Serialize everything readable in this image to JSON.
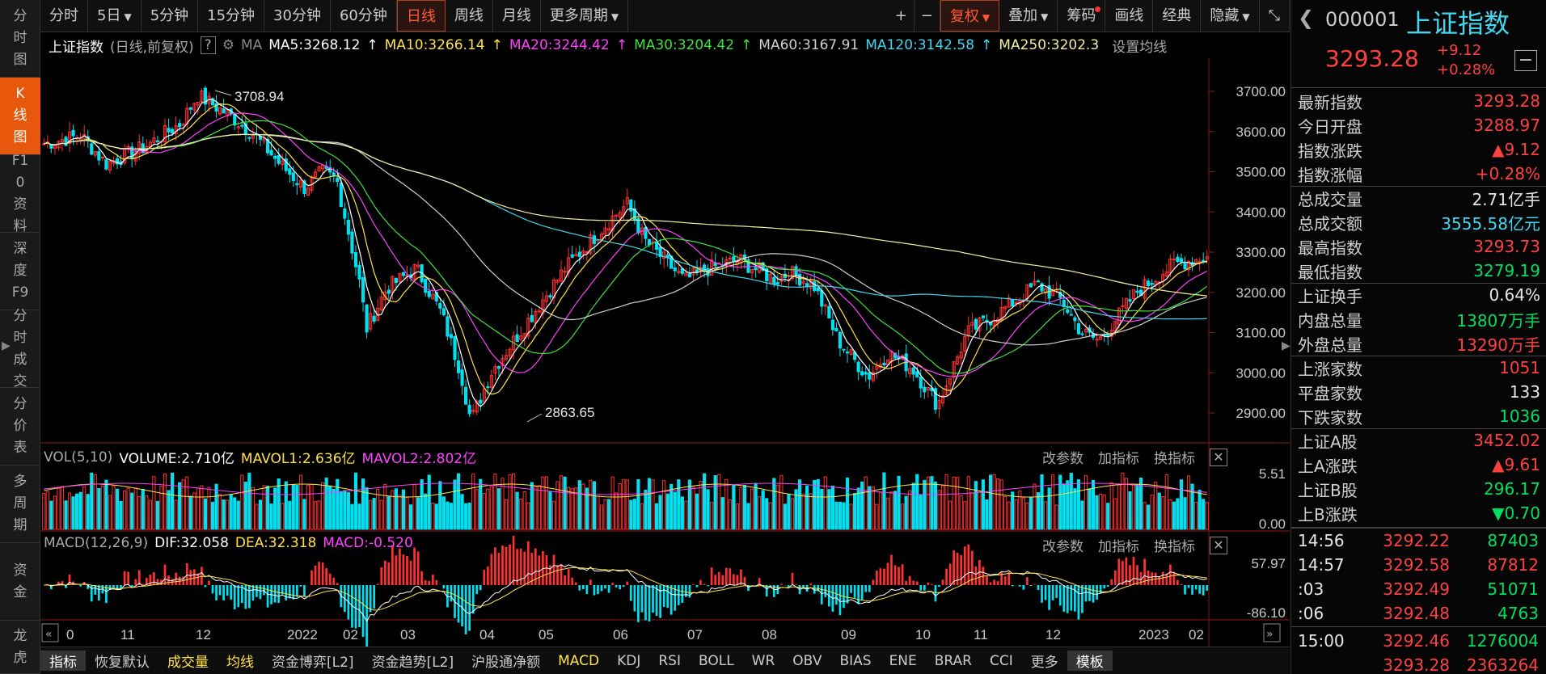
{
  "sidebar": [
    {
      "label": "分时图",
      "active": false
    },
    {
      "label": "K线图",
      "active": true
    },
    {
      "label": "F10资料",
      "active": false
    },
    {
      "label": "深度F9",
      "active": false
    },
    {
      "label": "分时成交",
      "active": false
    },
    {
      "label": "分价表",
      "active": false
    },
    {
      "label": "多周期",
      "active": false
    },
    {
      "label": "资金",
      "active": false
    },
    {
      "label": "龙虎",
      "active": false
    }
  ],
  "toolbar": {
    "periods": [
      "分时",
      "5日",
      "5分钟",
      "15分钟",
      "30分钟",
      "60分钟",
      "日线",
      "周线",
      "月线",
      "更多周期"
    ],
    "selected": "日线",
    "right": [
      "+",
      "−",
      "复权",
      "叠加",
      "筹码",
      "画线",
      "经典",
      "隐藏",
      "⤡"
    ]
  },
  "ma_bar": {
    "name": "上证指数",
    "mode": "(日线,前复权)",
    "help": "?",
    "ma_label": "MA",
    "items": [
      {
        "text": "MA5:3268.12",
        "color": "#ffffff"
      },
      {
        "text": "MA10:3266.14",
        "color": "#ffe24a"
      },
      {
        "text": "MA20:3244.42",
        "color": "#ff40ff"
      },
      {
        "text": "MA30:3204.42",
        "color": "#40e040"
      },
      {
        "text": "MA60:3167.91",
        "color": "#d0d0d0"
      },
      {
        "text": "MA120:3142.58",
        "color": "#40d8f0"
      },
      {
        "text": "MA250:3202.3",
        "color": "#f0f0a0"
      }
    ],
    "settings": "设置均线"
  },
  "kline": {
    "high_label": "3708.94",
    "low_label": "2863.65",
    "y_ticks": [
      "3700.00",
      "3600.00",
      "3500.00",
      "3400.00",
      "3300.00",
      "3200.00",
      "3100.00",
      "3000.00",
      "2900.00"
    ],
    "y_values": [
      3700,
      3600,
      3500,
      3400,
      3300,
      3200,
      3100,
      3000,
      2900
    ]
  },
  "vol_panel": {
    "title": "VOL(5,10)",
    "volume": "VOLUME:2.710亿",
    "mavol1": "MAVOL1:2.636亿",
    "mavol2": "MAVOL2:2.802亿",
    "ticks": [
      "5.51",
      "0.00"
    ],
    "buttons": [
      "改参数",
      "加指标",
      "换指标"
    ]
  },
  "macd_panel": {
    "title": "MACD(12,26,9)",
    "dif": "DIF:32.058",
    "dea": "DEA:32.318",
    "macd": "MACD:-0.520",
    "ticks": [
      "57.97",
      "-86.10"
    ],
    "buttons": [
      "改参数",
      "加指标",
      "换指标"
    ]
  },
  "x_axis": [
    "0",
    "11",
    "12",
    "2022",
    "02",
    "03",
    "04",
    "05",
    "06",
    "07",
    "08",
    "09",
    "10",
    "11",
    "12",
    "2023",
    "02"
  ],
  "bottom": {
    "items": [
      "指标",
      "恢复默认",
      "成交量",
      "均线",
      "资金博弈[L2]",
      "资金趋势[L2]",
      "沪股通净额",
      "MACD",
      "KDJ",
      "RSI",
      "BOLL",
      "WR",
      "OBV",
      "BIAS",
      "ENE",
      "BRAR",
      "CCI",
      "更多",
      "模板"
    ]
  },
  "quote": {
    "code": "000001",
    "name": "上证指数",
    "price": "3293.28",
    "change": "+9.12",
    "pct": "+0.28%",
    "stats": [
      {
        "k": "最新指数",
        "v": "3293.28",
        "c": "red"
      },
      {
        "k": "今日开盘",
        "v": "3288.97",
        "c": "red"
      },
      {
        "k": "指数涨跌",
        "v": "▲9.12",
        "c": "red"
      },
      {
        "k": "指数涨幅",
        "v": "+0.28%",
        "c": "red"
      },
      {
        "k": "总成交量",
        "v": "2.71亿手",
        "c": "wht"
      },
      {
        "k": "总成交额",
        "v": "3555.58亿元",
        "c": "cya"
      },
      {
        "k": "最高指数",
        "v": "3293.73",
        "c": "red"
      },
      {
        "k": "最低指数",
        "v": "3279.19",
        "c": "grn"
      },
      {
        "k": "上证换手",
        "v": "0.64%",
        "c": "wht"
      },
      {
        "k": "内盘总量",
        "v": "13807万手",
        "c": "grn"
      },
      {
        "k": "外盘总量",
        "v": "13290万手",
        "c": "red"
      },
      {
        "k": "上涨家数",
        "v": "1051",
        "c": "red"
      },
      {
        "k": "平盘家数",
        "v": "133",
        "c": "wht"
      },
      {
        "k": "下跌家数",
        "v": "1036",
        "c": "grn"
      },
      {
        "k": "上证A股",
        "v": "3452.02",
        "c": "red"
      },
      {
        "k": "上A涨跌",
        "v": "▲9.61",
        "c": "red"
      },
      {
        "k": "上证B股",
        "v": "296.17",
        "c": "grn"
      },
      {
        "k": "上B涨跌",
        "v": "▼0.70",
        "c": "grn"
      }
    ],
    "ticks": [
      {
        "t": "14:56",
        "p": "3292.22",
        "pc": "red",
        "v": "87403",
        "vc": "grn"
      },
      {
        "t": "14:57",
        "p": "3292.58",
        "pc": "red",
        "v": "87812",
        "vc": "red"
      },
      {
        "t": ":03",
        "p": "3292.49",
        "pc": "red",
        "v": "51071",
        "vc": "grn"
      },
      {
        "t": ":06",
        "p": "3292.48",
        "pc": "red",
        "v": "4763",
        "vc": "grn"
      },
      {
        "t": "15:00",
        "p": "3292.46",
        "pc": "red",
        "v": "1276004",
        "vc": "grn"
      },
      {
        "t": "",
        "p": "3293.28",
        "pc": "red",
        "v": "2363264",
        "vc": "red"
      }
    ]
  }
}
